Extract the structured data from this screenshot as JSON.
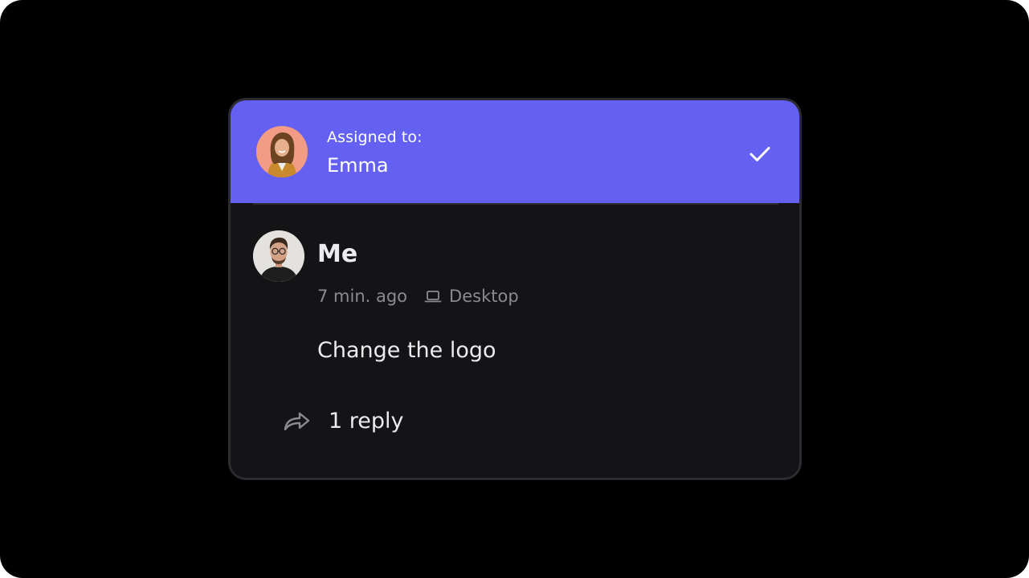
{
  "assignment": {
    "label": "Assigned to:",
    "assignee_name": "Emma",
    "avatar_icon": "emma-avatar",
    "action_icon": "check-icon",
    "bar_color": "#6360f2"
  },
  "comment": {
    "author": "Me",
    "avatar_icon": "user-avatar",
    "time": "7 min. ago",
    "device_icon": "laptop-icon",
    "device": "Desktop",
    "text": "Change the logo"
  },
  "replies": {
    "icon": "reply-arrow-icon",
    "label": "1 reply"
  }
}
